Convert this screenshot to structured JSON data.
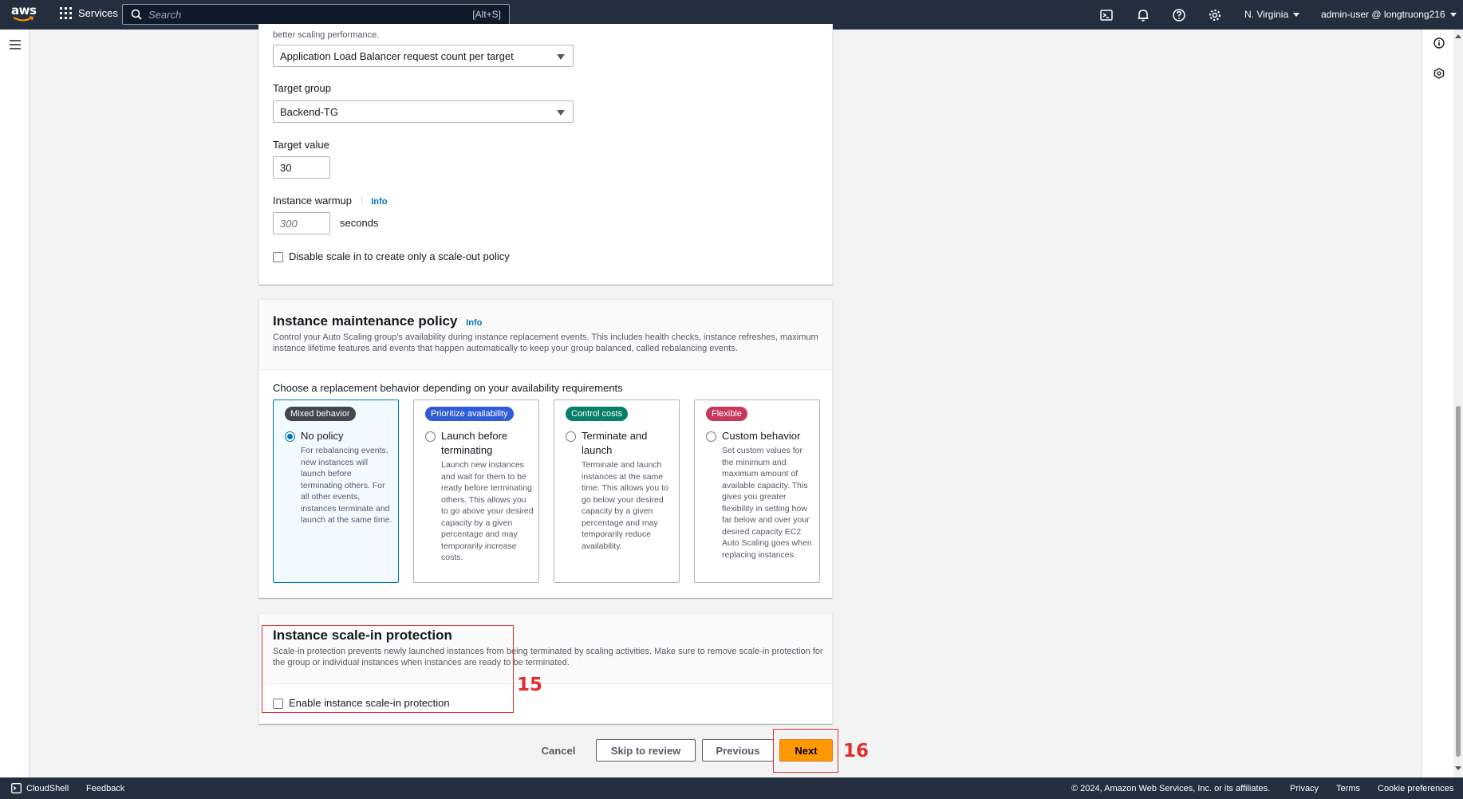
{
  "nav": {
    "logo": "aws",
    "services_label": "Services",
    "search_placeholder": "Search",
    "search_shortcut": "[Alt+S]",
    "region": "N. Virginia",
    "account": "admin-user @ longtruong216"
  },
  "scaling": {
    "truncated_text": "better scaling performance.",
    "metric_value": "Application Load Balancer request count per target",
    "target_group_label": "Target group",
    "target_group_value": "Backend-TG",
    "target_value_label": "Target value",
    "target_value": "30",
    "warmup_label": "Instance warmup",
    "warmup_info": "Info",
    "warmup_placeholder": "300",
    "warmup_unit": "seconds",
    "disable_scale_in_label": "Disable scale in to create only a scale-out policy"
  },
  "maintenance": {
    "title": "Instance maintenance policy",
    "info": "Info",
    "description": "Control your Auto Scaling group's availability during instance replacement events. This includes health checks, instance refreshes, maximum instance lifetime features and events that happen automatically to keep your group balanced, called rebalancing events.",
    "choose_label": "Choose a replacement behavior depending on your availability requirements",
    "options": [
      {
        "badge": "Mixed behavior",
        "badge_color": "#414750",
        "title": "No policy",
        "description": "For rebalancing events, new instances will launch before terminating others. For all other events, instances terminate and launch at the same time.",
        "selected": true
      },
      {
        "badge": "Prioritize availability",
        "badge_color": "#2f5bd6",
        "title": "Launch before terminating",
        "description": "Launch new instances and wait for them to be ready before terminating others. This allows you to go above your desired capacity by a given percentage and may temporarily increase costs.",
        "selected": false
      },
      {
        "badge": "Control costs",
        "badge_color": "#067f68",
        "title": "Terminate and launch",
        "description": "Terminate and launch instances at the same time. This allows you to go below your desired capacity by a given percentage and may temporarily reduce availability.",
        "selected": false
      },
      {
        "badge": "Flexible",
        "badge_color": "#c7385d",
        "title": "Custom behavior",
        "description": "Set custom values for the minimum and maximum amount of available capacity. This gives you greater flexibility in setting how far below and over your desired capacity EC2 Auto Scaling goes when replacing instances.",
        "selected": false
      }
    ]
  },
  "protection": {
    "title": "Instance scale-in protection",
    "description": "Scale-in protection prevents newly launched instances from being terminated by scaling activities. Make sure to remove scale-in protection for the group or individual instances when instances are ready to be terminated.",
    "checkbox_label": "Enable instance scale-in protection"
  },
  "actions": {
    "cancel": "Cancel",
    "skip": "Skip to review",
    "previous": "Previous",
    "next": "Next"
  },
  "annotations": {
    "protection_step": "15",
    "next_step": "16"
  },
  "footer": {
    "cloudshell": "CloudShell",
    "feedback": "Feedback",
    "copyright": "© 2024, Amazon Web Services, Inc. or its affiliates.",
    "privacy": "Privacy",
    "terms": "Terms",
    "cookies": "Cookie preferences"
  }
}
